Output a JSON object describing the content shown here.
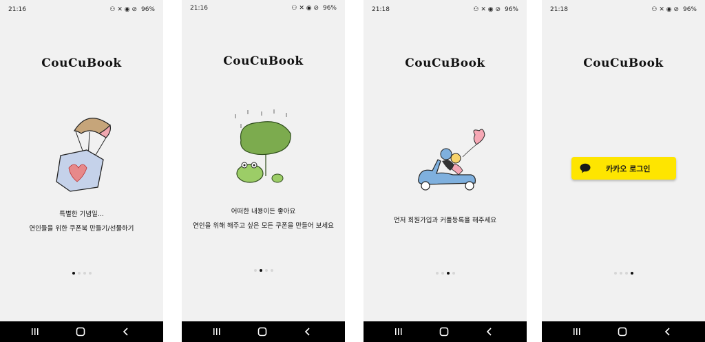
{
  "app_name": "CouCuBook",
  "screens": [
    {
      "time": "21:16",
      "battery": "96%",
      "caption_line1": "특별한 기념일...",
      "caption_line2": "연인들을 위한 쿠폰북 만들기/선물하기",
      "illustration": "parachute-gift-icon"
    },
    {
      "time": "21:16",
      "battery": "96%",
      "caption_line1": "어떠한 내용이든 좋아요",
      "caption_line2": "연인을 위해 해주고 싶은 모든 쿠폰을 만들어 보세요",
      "illustration": "frogs-leaf-umbrella-icon"
    },
    {
      "time": "21:18",
      "battery": "96%",
      "caption_line1": "먼저 회원가입과 커플등록을 해주세요",
      "illustration": "couple-scooter-icon"
    },
    {
      "time": "21:18",
      "battery": "96%",
      "kakao_login_label": "카카오 로그인",
      "illustration": ""
    }
  ],
  "page_indicator": {
    "count": 4
  },
  "colors": {
    "background": "#f1f1f1",
    "kakao_yellow": "#fee500",
    "navbar": "#000000"
  }
}
